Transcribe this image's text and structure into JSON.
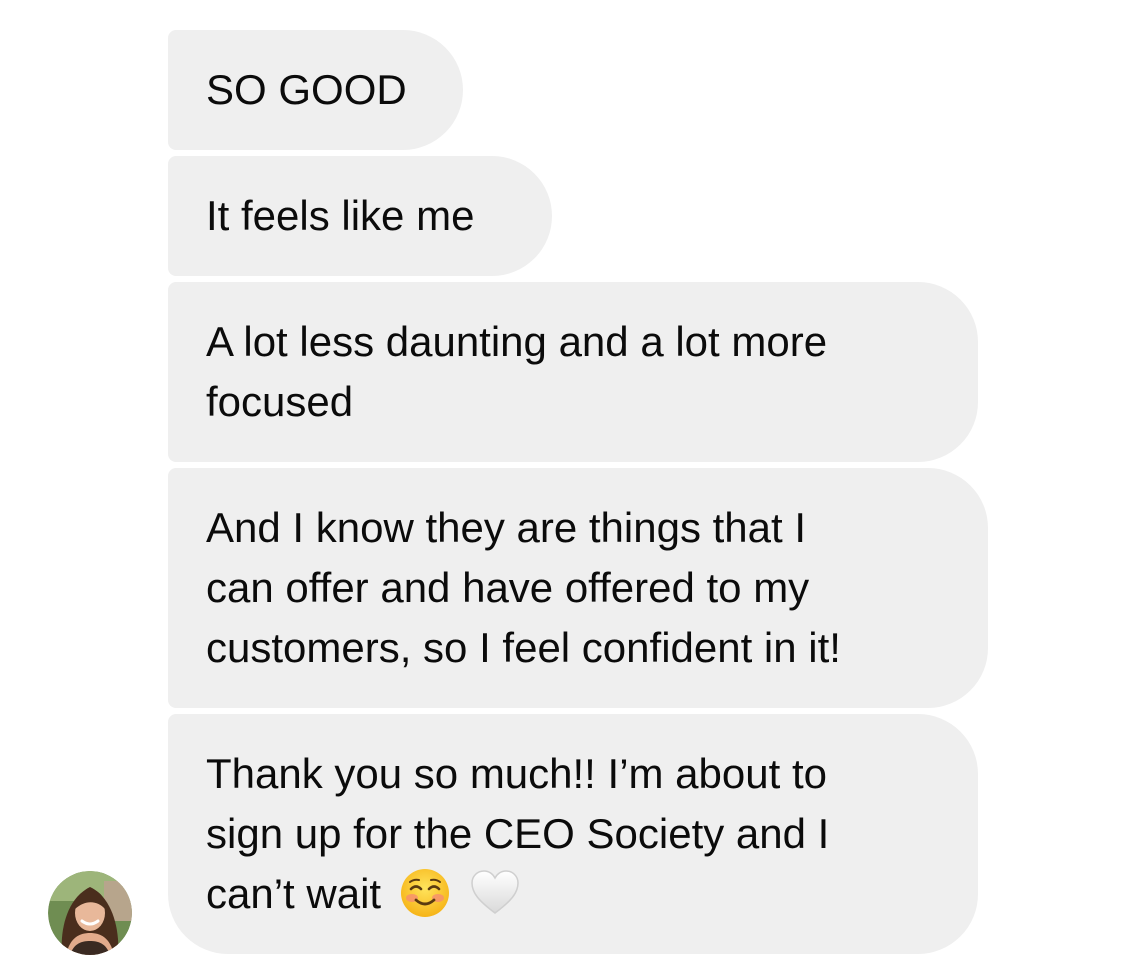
{
  "messages": [
    {
      "lines": [
        "SO GOOD"
      ]
    },
    {
      "lines": [
        "It feels like me"
      ]
    },
    {
      "lines": [
        "A lot less daunting and a lot more",
        "focused"
      ]
    },
    {
      "lines": [
        "And I know they are things that I",
        "can offer and have offered to my",
        "customers, so I feel confident in it!"
      ]
    },
    {
      "lines": [
        "Thank you so much!! I’m about to",
        "sign up for the CEO Society and I",
        "can’t wait"
      ],
      "emojis": [
        "smiling-face-emoji",
        "white-heart-emoji"
      ]
    }
  ],
  "sender": {
    "avatar_icon": "profile-photo-avatar"
  },
  "colors": {
    "bubble_background": "#efefef",
    "text": "#0b0b0b",
    "page_background": "#ffffff"
  }
}
